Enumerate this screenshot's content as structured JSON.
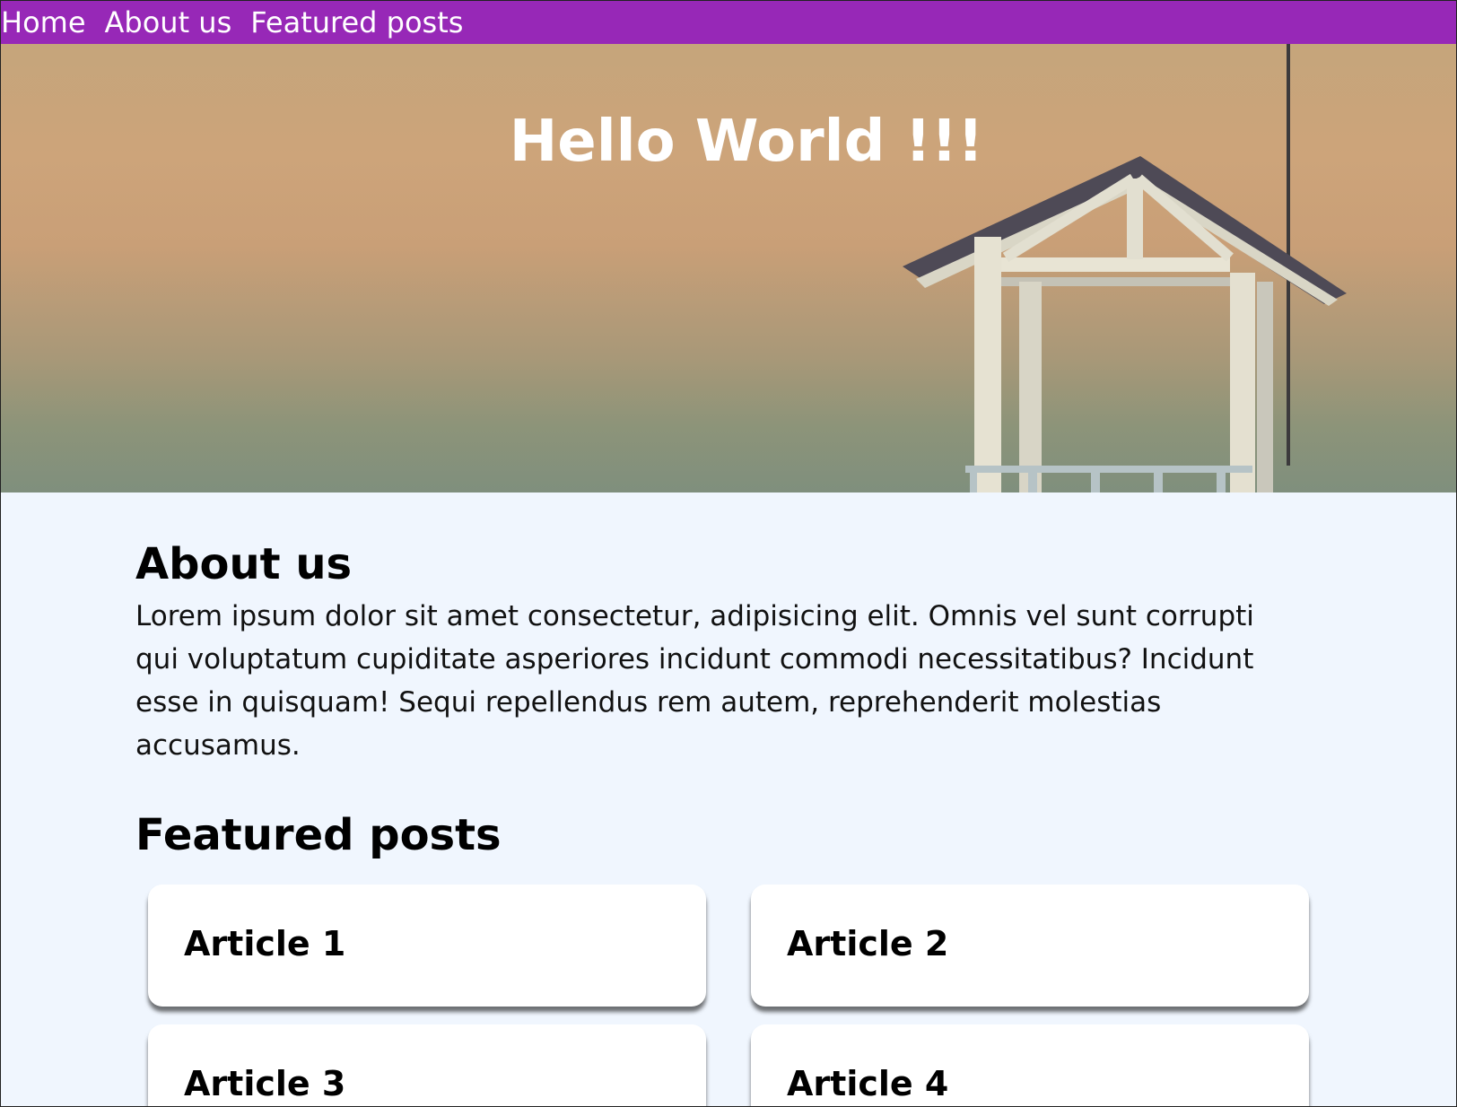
{
  "nav": {
    "items": [
      {
        "label": "Home"
      },
      {
        "label": "About us"
      },
      {
        "label": "Featured posts"
      }
    ]
  },
  "hero": {
    "title": "Hello World !!!"
  },
  "about": {
    "heading": "About us",
    "text": "Lorem ipsum dolor sit amet consectetur, adipisicing elit. Omnis vel sunt corrupti qui voluptatum cupiditate asperiores incidunt commodi necessitatibus? Incidunt esse in quisquam! Sequi repellendus rem autem, reprehenderit molestias accusamus."
  },
  "featured": {
    "heading": "Featured posts",
    "articles": [
      {
        "title": "Article 1"
      },
      {
        "title": "Article 2"
      },
      {
        "title": "Article 3"
      },
      {
        "title": "Article 4"
      }
    ]
  },
  "colors": {
    "nav_bg": "#9728b7",
    "page_bg": "#f0f6fe",
    "card_bg": "#ffffff"
  }
}
